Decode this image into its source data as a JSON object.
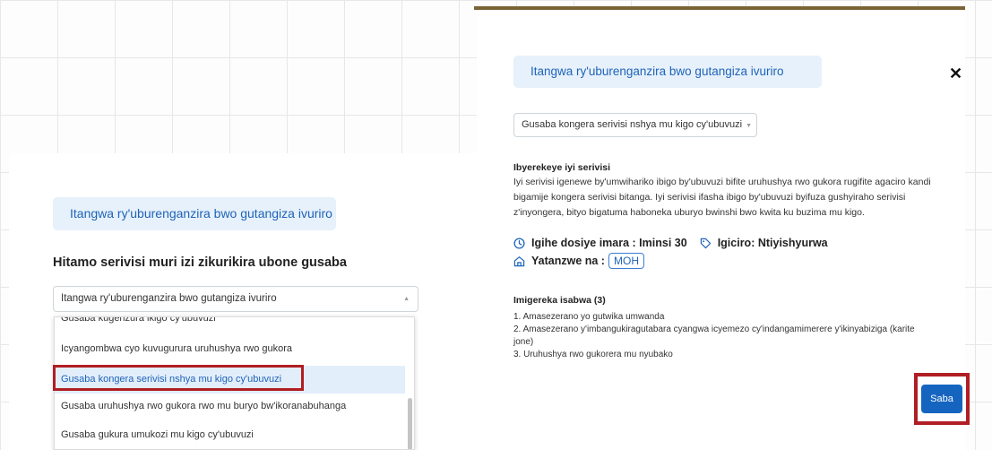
{
  "left_panel": {
    "service_title": "Itangwa ry'uburenganzira bwo gutangiza ivuriro",
    "choose_label": "Hitamo serivisi muri izi zikurikira ubone gusaba",
    "select_value": "Itangwa ry'uburenganzira bwo gutangiza ivuriro",
    "options": [
      "Gusaba kugenzura ikigo cy'ubuvuzi",
      "Icyangombwa cyo kuvugurura uruhushya rwo gukora",
      "Gusaba kongera serivisi nshya mu kigo cy'ubuvuzi",
      "Gusaba uruhushya rwo gukora rwo mu buryo bw'ikoranabuhanga",
      "Gusaba gukura umukozi mu kigo cy'ubuvuzi"
    ],
    "selected_option_index": 2
  },
  "modal": {
    "title": "Itangwa ry'uburenganzira bwo gutangiza ivuriro",
    "select_value": "Gusaba kongera serivisi nshya mu kigo cy'ubuvuzi",
    "description_heading": "Ibyerekeye iyi serivisi",
    "description_lines": [
      "Iyi serivisi igenewe by'umwihariko ibigo by'ubuvuzi bifite uruhushya rwo gukora rugifite agaciro kandi",
      "bigamije kongera serivisi bitanga. Iyi serivisi ifasha ibigo by'ubuvuzi byifuza gushyiraho serivisi",
      "z'inyongera, bityo bigatuma haboneka uburyo bwinshi bwo kwita ku buzima mu kigo."
    ],
    "duration_text": "Igihe dosiye imara : Iminsi 30",
    "price_text": "Igiciro: Ntiyishyurwa",
    "approved_by_label": "Yatanzwe na :",
    "approved_by_value": "MOH",
    "requirements_heading": "Imigereka isabwa (3)",
    "requirements": [
      "1. Amasezerano yo gutwika umwanda",
      "2. Amasezerano y'imbangukiragutabara cyangwa icyemezo cy'indangamimerere y'ikinyabiziga (karite",
      "jone)",
      "3. Uruhushya rwo gukorera mu nyubako"
    ],
    "submit_label": "Saba",
    "close_symbol": "✕"
  },
  "colors": {
    "accent": "#1565c0",
    "title_bg": "#e7f1fb",
    "highlight_red": "#b01e23",
    "topbar": "#7a6335"
  },
  "icons": [
    "clock-icon",
    "tag-icon",
    "building-icon",
    "close-icon",
    "chevron-down-icon"
  ]
}
